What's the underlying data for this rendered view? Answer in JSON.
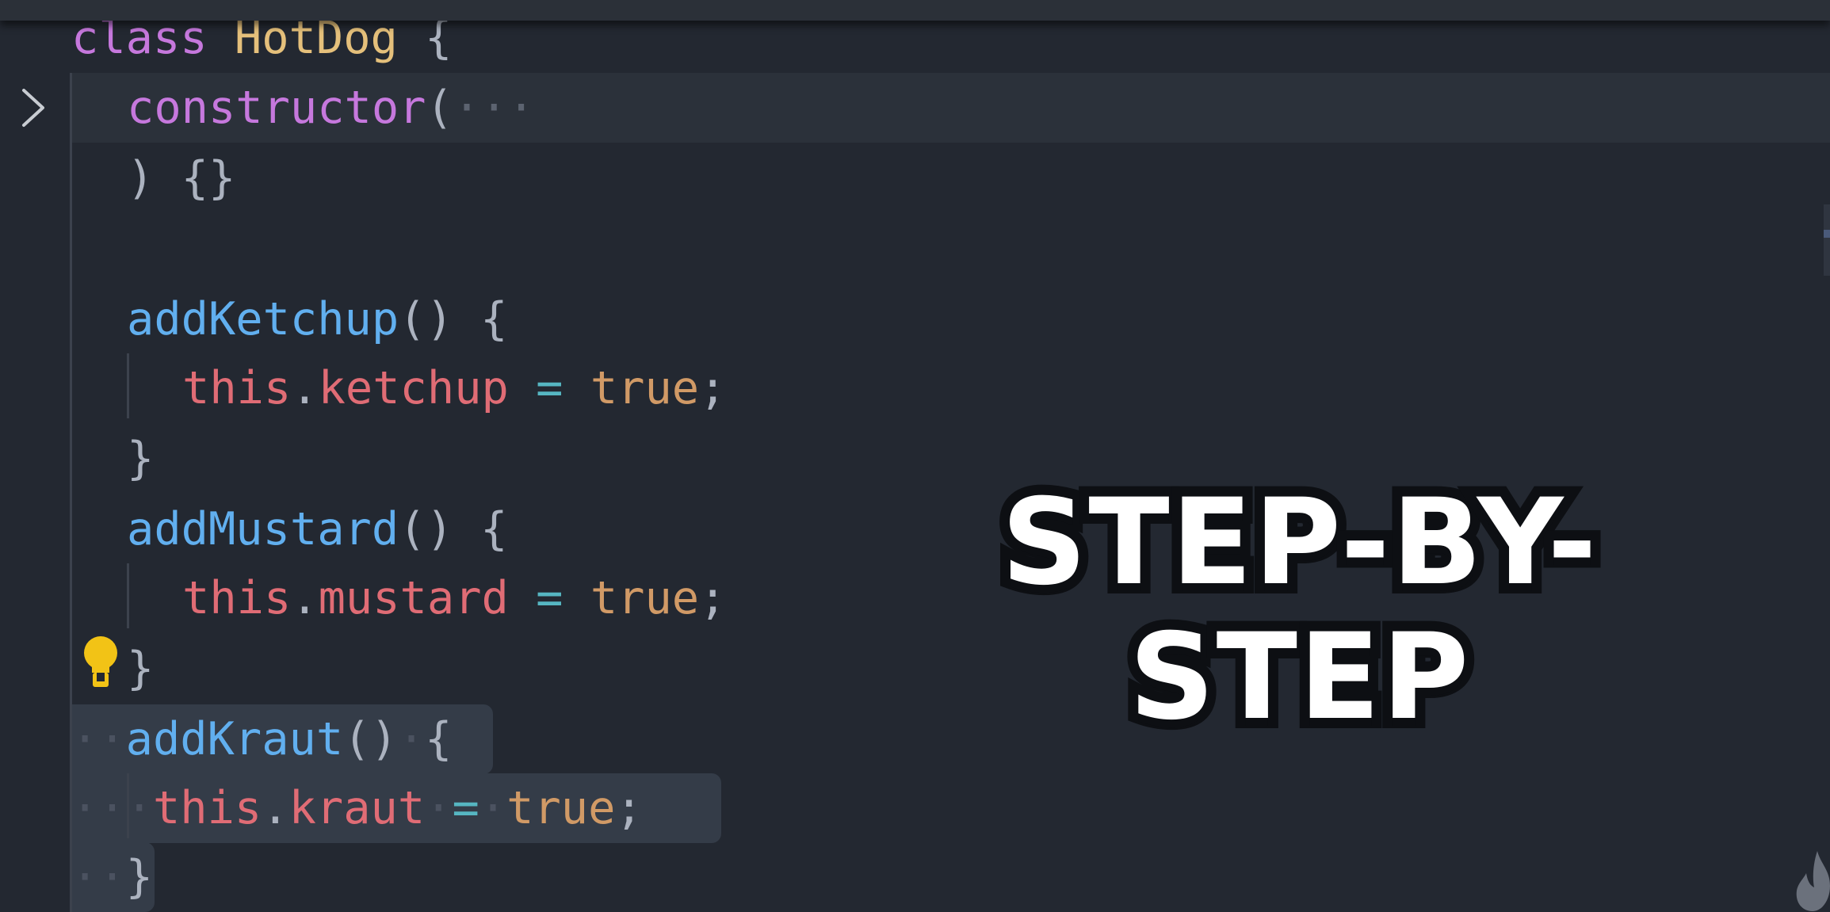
{
  "editor": {
    "lines": [
      {
        "id": "l1",
        "tokens": [
          {
            "t": "class",
            "c": "kw"
          },
          {
            "t": " ",
            "c": "pun"
          },
          {
            "t": "HotDog",
            "c": "cls"
          },
          {
            "t": " {",
            "c": "pun"
          }
        ]
      },
      {
        "id": "l2",
        "tokens": [
          {
            "t": "constructor",
            "c": "kw"
          },
          {
            "t": "(",
            "c": "pun"
          },
          {
            "t": "···",
            "c": "dim"
          }
        ]
      },
      {
        "id": "l3",
        "tokens": [
          {
            "t": ") {}",
            "c": "pun"
          }
        ]
      },
      {
        "id": "l4",
        "tokens": []
      },
      {
        "id": "l5",
        "tokens": [
          {
            "t": "addKetchup",
            "c": "fn"
          },
          {
            "t": "() {",
            "c": "pun"
          }
        ]
      },
      {
        "id": "l6",
        "tokens": [
          {
            "t": "this",
            "c": "ths"
          },
          {
            "t": ".",
            "c": "pun"
          },
          {
            "t": "ketchup",
            "c": "prop"
          },
          {
            "t": " ",
            "c": "pun"
          },
          {
            "t": "=",
            "c": "op"
          },
          {
            "t": " ",
            "c": "pun"
          },
          {
            "t": "true",
            "c": "lit"
          },
          {
            "t": ";",
            "c": "pun"
          }
        ]
      },
      {
        "id": "l7",
        "tokens": [
          {
            "t": "}",
            "c": "pun"
          }
        ]
      },
      {
        "id": "l8",
        "tokens": [
          {
            "t": "addMustard",
            "c": "fn"
          },
          {
            "t": "() {",
            "c": "pun"
          }
        ]
      },
      {
        "id": "l9",
        "tokens": [
          {
            "t": "this",
            "c": "ths"
          },
          {
            "t": ".",
            "c": "pun"
          },
          {
            "t": "mustard",
            "c": "prop"
          },
          {
            "t": " ",
            "c": "pun"
          },
          {
            "t": "=",
            "c": "op"
          },
          {
            "t": " ",
            "c": "pun"
          },
          {
            "t": "true",
            "c": "lit"
          },
          {
            "t": ";",
            "c": "pun"
          }
        ]
      },
      {
        "id": "l10",
        "tokens": [
          {
            "t": "}",
            "c": "pun"
          }
        ]
      },
      {
        "id": "l11",
        "tokens": [
          {
            "t": "··",
            "c": "ws"
          },
          {
            "t": "addKraut",
            "c": "fn"
          },
          {
            "t": "()",
            "c": "pun"
          },
          {
            "t": "·",
            "c": "ws"
          },
          {
            "t": "{",
            "c": "pun"
          }
        ]
      },
      {
        "id": "l12",
        "tokens": [
          {
            "t": "··",
            "c": "ws"
          },
          {
            "t": "·",
            "c": "ws"
          },
          {
            "t": "this",
            "c": "ths"
          },
          {
            "t": ".",
            "c": "pun"
          },
          {
            "t": "kraut",
            "c": "prop"
          },
          {
            "t": "·",
            "c": "ws"
          },
          {
            "t": "=",
            "c": "op"
          },
          {
            "t": "·",
            "c": "ws"
          },
          {
            "t": "true",
            "c": "lit"
          },
          {
            "t": ";",
            "c": "pun"
          }
        ]
      },
      {
        "id": "l13",
        "tokens": [
          {
            "t": "··",
            "c": "ws"
          },
          {
            "t": "}",
            "c": "pun"
          }
        ]
      }
    ],
    "colors": {
      "background": "#232831",
      "keyword": "#c678dd",
      "class_name": "#e5c07b",
      "function": "#61afef",
      "this_property": "#e06c75",
      "operator": "#56b6c2",
      "literal": "#d19a66",
      "punctuation": "#abb2bf",
      "selection": "#343c48"
    },
    "icons": {
      "fold": "chevron-right-icon",
      "code_action": "lightbulb-icon",
      "brand": "flame-icon"
    }
  },
  "overlay": {
    "title": "STEP-BY-STEP"
  }
}
